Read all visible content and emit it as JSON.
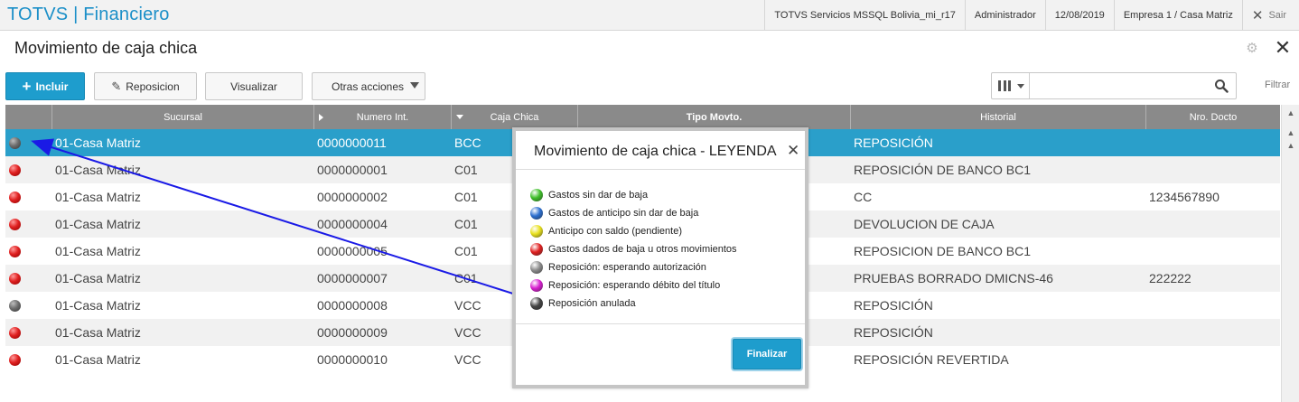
{
  "header": {
    "app_title": "TOTVS | Financiero",
    "server": "TOTVS Servicios MSSQL Bolivia_mi_r17",
    "user": "Administrador",
    "date": "12/08/2019",
    "company": "Empresa 1 / Casa Matriz",
    "exit_label": "Sair"
  },
  "page": {
    "title": "Movimiento de caja chica"
  },
  "toolbar": {
    "incluir": "Incluir",
    "reposicion": "Reposicion",
    "visualizar": "Visualizar",
    "otras_acciones": "Otras acciones",
    "filter_label": "Filtrar",
    "search_placeholder": ""
  },
  "grid": {
    "columns": [
      "",
      "Sucursal",
      "Numero Int.",
      "Caja Chica",
      "Tipo Movto.",
      "Historial",
      "Nro. Docto"
    ],
    "rows": [
      {
        "status": "gray",
        "sucursal": "01-Casa Matriz",
        "numero": "0000000011",
        "caja": "BCC",
        "tipo": "",
        "historial": "REPOSICIÓN",
        "docto": ""
      },
      {
        "status": "red",
        "sucursal": "01-Casa Matriz",
        "numero": "0000000001",
        "caja": "C01",
        "tipo": "",
        "historial": "REPOSICIÓN DE BANCO BC1",
        "docto": ""
      },
      {
        "status": "red",
        "sucursal": "01-Casa Matriz",
        "numero": "0000000002",
        "caja": "C01",
        "tipo": "",
        "historial": "CC",
        "docto": "1234567890"
      },
      {
        "status": "red",
        "sucursal": "01-Casa Matriz",
        "numero": "0000000004",
        "caja": "C01",
        "tipo": "",
        "historial": "DEVOLUCION DE CAJA",
        "docto": ""
      },
      {
        "status": "red",
        "sucursal": "01-Casa Matriz",
        "numero": "0000000005",
        "caja": "C01",
        "tipo": "",
        "historial": "REPOSICION DE BANCO BC1",
        "docto": ""
      },
      {
        "status": "red",
        "sucursal": "01-Casa Matriz",
        "numero": "0000000007",
        "caja": "C01",
        "tipo": "",
        "historial": "PRUEBAS BORRADO DMICNS-46",
        "docto": "222222"
      },
      {
        "status": "gray",
        "sucursal": "01-Casa Matriz",
        "numero": "0000000008",
        "caja": "VCC",
        "tipo": "",
        "historial": "REPOSICIÓN",
        "docto": ""
      },
      {
        "status": "red",
        "sucursal": "01-Casa Matriz",
        "numero": "0000000009",
        "caja": "VCC",
        "tipo": "",
        "historial": "REPOSICIÓN",
        "docto": ""
      },
      {
        "status": "red",
        "sucursal": "01-Casa Matriz",
        "numero": "0000000010",
        "caja": "VCC",
        "tipo": "",
        "historial": "REPOSICIÓN REVERTIDA",
        "docto": ""
      }
    ]
  },
  "dialog": {
    "title": "Movimiento de caja chica - LEYENDA",
    "items": [
      {
        "label": "Gastos sin dar de baja",
        "color": "#3fbf2a"
      },
      {
        "label": "Gastos de anticipo sin dar de baja",
        "color": "#2c6fd0"
      },
      {
        "label": "Anticipo con saldo (pendiente)",
        "color": "#e8e01c"
      },
      {
        "label": "Gastos dados de baja u otros movimientos",
        "color": "#e02020"
      },
      {
        "label": "Reposición: esperando autorización",
        "color": "#8c8c8c"
      },
      {
        "label": "Reposición: esperando débito del título",
        "color": "#d81fd0"
      },
      {
        "label": "Reposición anulada",
        "color": "#444444"
      }
    ],
    "finalizar": "Finalizar"
  },
  "colors": {
    "accent": "#1e9dcd",
    "selected_row": "#2a9fca",
    "grid_header": "#8a8a8a",
    "annotation_arrow": "#1a1ae6"
  }
}
